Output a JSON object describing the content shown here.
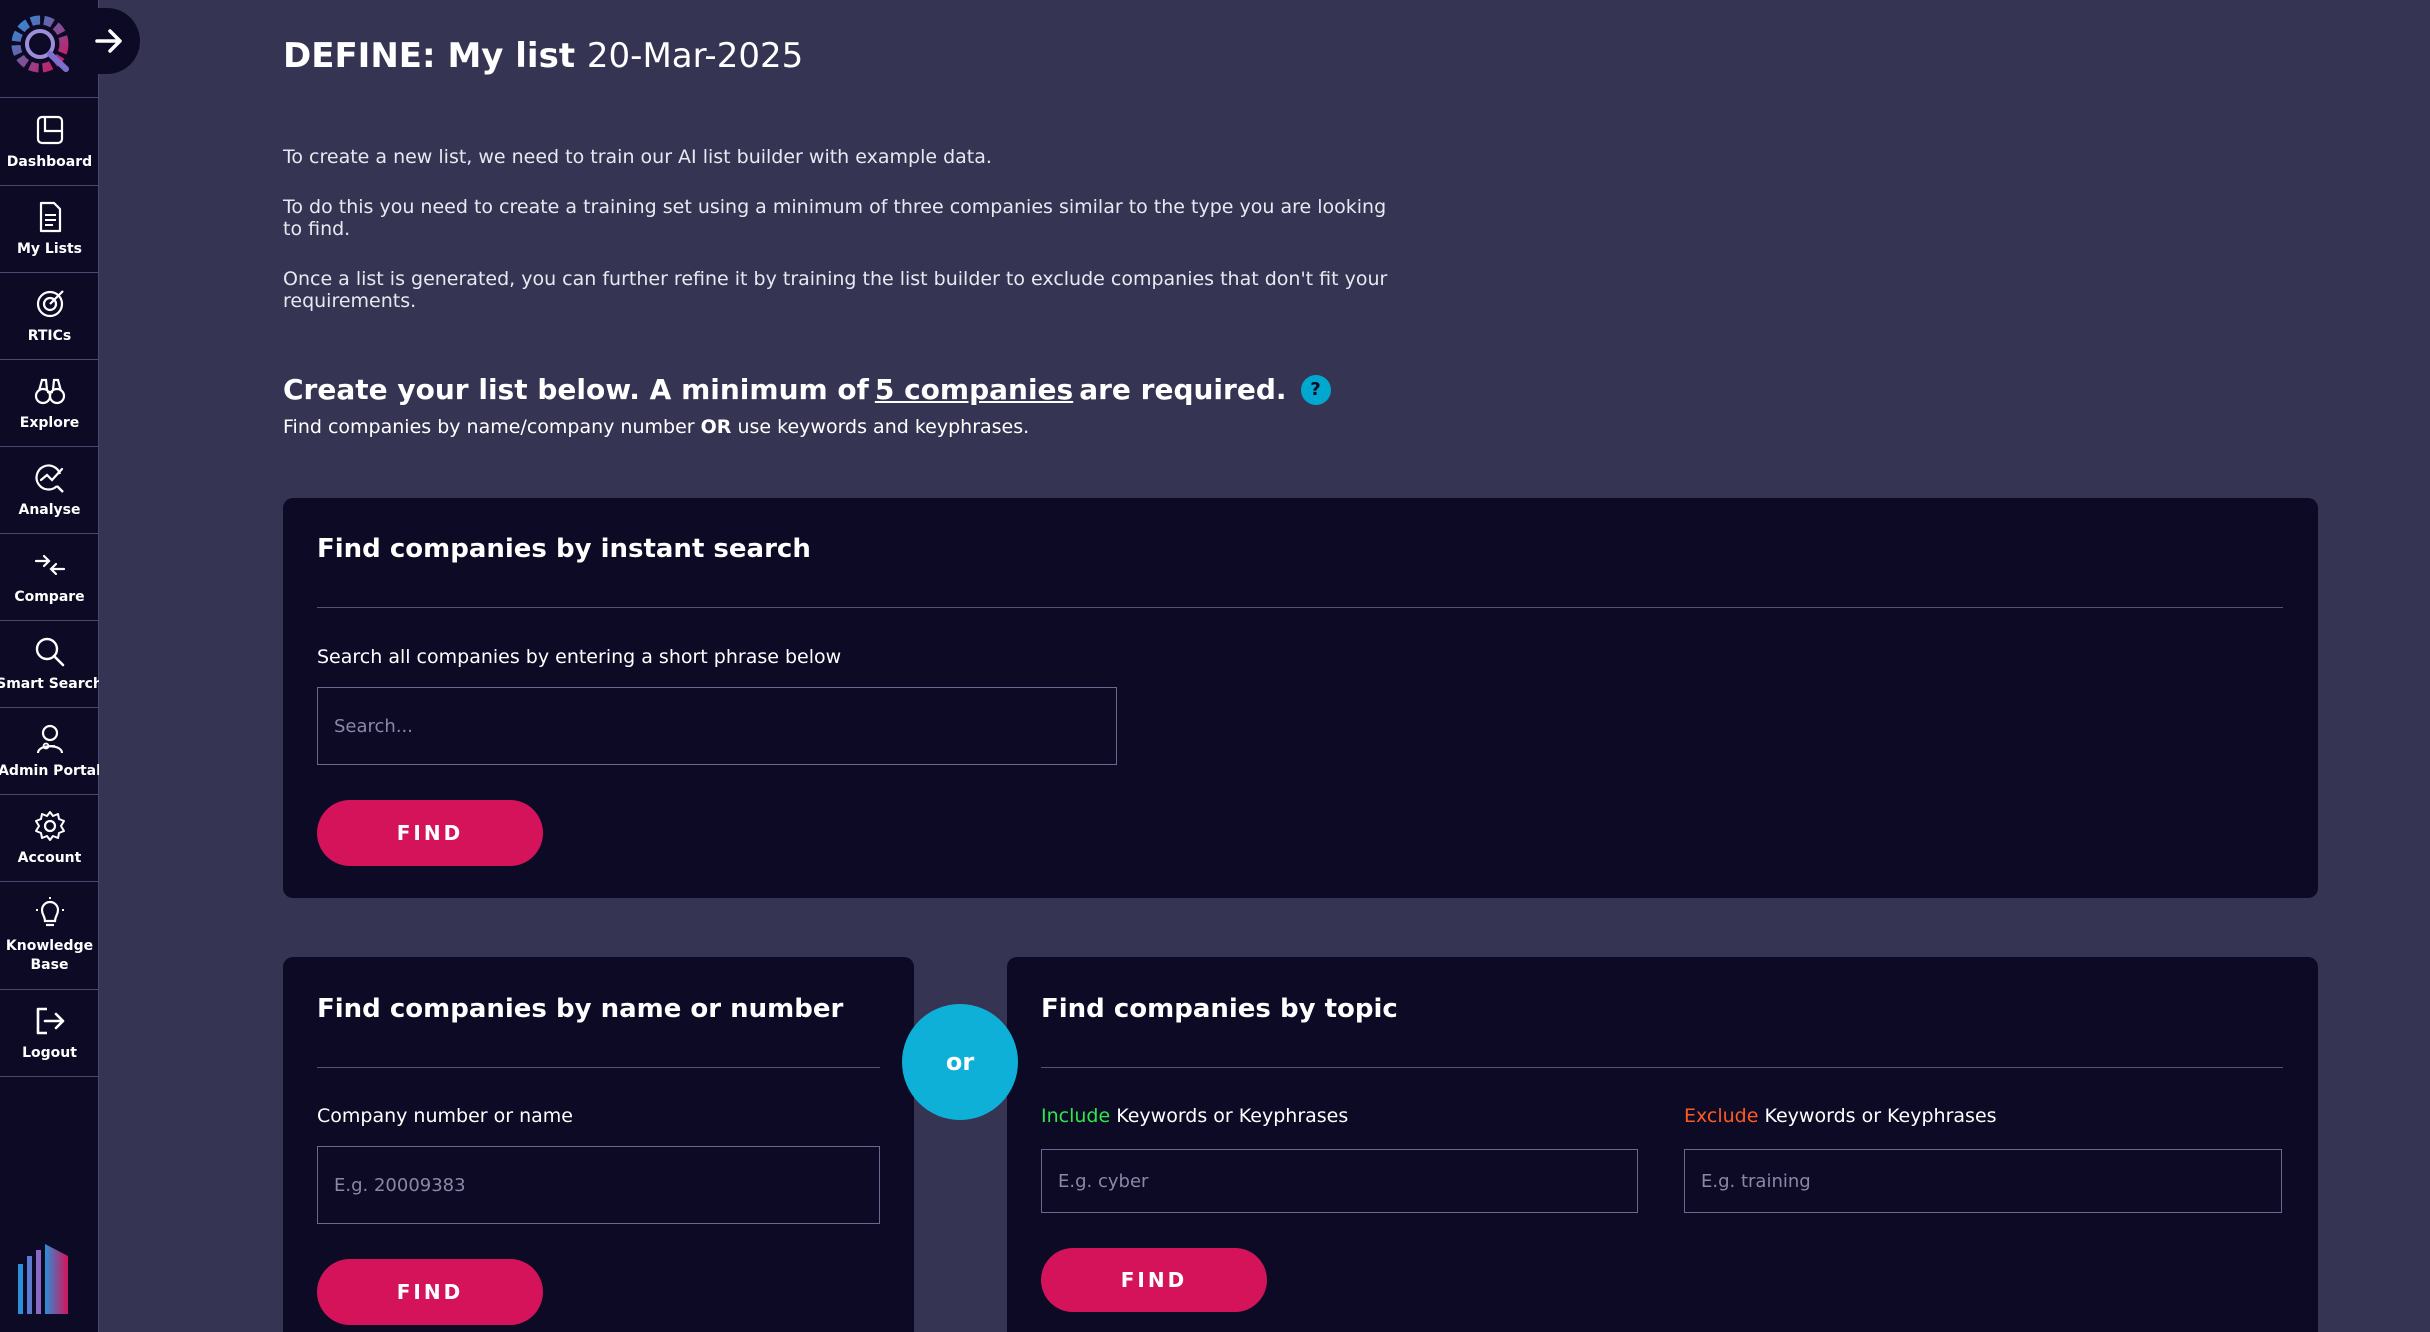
{
  "sidebar": {
    "items": [
      {
        "label": "Dashboard",
        "icon": "dashboard-icon"
      },
      {
        "label": "My Lists",
        "icon": "document-list-icon"
      },
      {
        "label": "RTICs",
        "icon": "target-icon"
      },
      {
        "label": "Explore",
        "icon": "binoculars-icon"
      },
      {
        "label": "Analyse",
        "icon": "chart-analyse-icon"
      },
      {
        "label": "Compare",
        "icon": "compare-arrows-icon"
      },
      {
        "label": "Smart Search",
        "icon": "search-icon"
      },
      {
        "label": "Admin Portal",
        "icon": "admin-user-icon"
      },
      {
        "label": "Account",
        "icon": "gear-icon"
      },
      {
        "label": "Knowledge Base",
        "icon": "lightbulb-icon"
      },
      {
        "label": "Logout",
        "icon": "logout-icon"
      }
    ]
  },
  "page": {
    "title_bold": "DEFINE: My list",
    "title_light": "20-Mar-2025",
    "intro_1": "To create a new list, we need to train our AI list builder with example data.",
    "intro_2": "To do this you need to create a training set using a minimum of three companies similar to the type you are looking to find.",
    "intro_3": "Once a list is generated, you can further refine it by training the list builder to exclude companies that don't fit your requirements.",
    "create_prefix": "Create your list below. A minimum of",
    "create_link": "5 companies",
    "create_suffix": "are required.",
    "help_symbol": "?",
    "sub_prefix": "Find companies by name/company number",
    "sub_or": "OR",
    "sub_suffix": "use keywords and keyphrases."
  },
  "instant": {
    "title": "Find companies by instant search",
    "label": "Search all companies by entering a short phrase below",
    "placeholder": "Search...",
    "button": "FIND"
  },
  "name_number": {
    "title": "Find companies by name or number",
    "label": "Company number or name",
    "placeholder": "E.g. 20009383",
    "button": "FIND"
  },
  "or_label": "or",
  "topic": {
    "title": "Find companies by topic",
    "include_word": "Include",
    "include_rest": "Keywords or Keyphrases",
    "include_placeholder": "E.g. cyber",
    "exclude_word": "Exclude",
    "exclude_rest": "Keywords or Keyphrases",
    "exclude_placeholder": "E.g. training",
    "button": "FIND"
  },
  "colors": {
    "background": "#363453",
    "panel": "#0d0a26",
    "accent_button": "#d4135a",
    "or_circle": "#0fb0d8",
    "include": "#2ee84a",
    "exclude": "#ff5a1f"
  }
}
